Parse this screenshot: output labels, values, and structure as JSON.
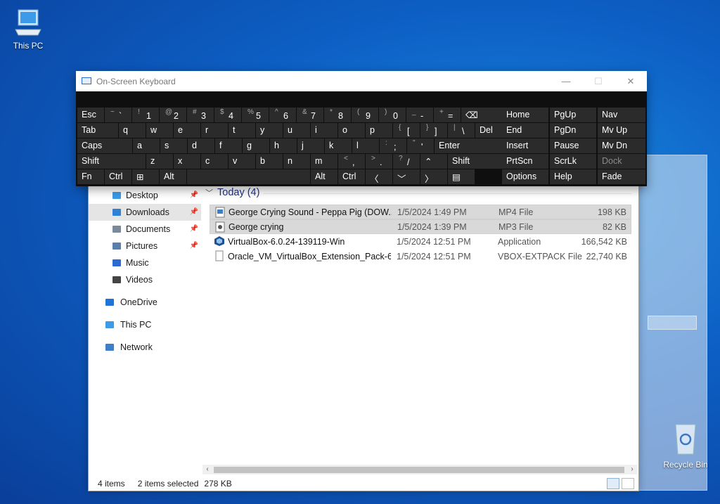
{
  "desktop": {
    "this_pc_label": "This PC",
    "recycle_bin_label": "Recycle Bin"
  },
  "osk": {
    "title": "On-Screen Keyboard",
    "window_controls": {
      "minimize": "—",
      "maximize": "☐",
      "close": "✕"
    },
    "rows": [
      [
        {
          "id": "esc",
          "label": "Esc"
        },
        {
          "id": "tilde",
          "shift": "~",
          "main": "`"
        },
        {
          "id": "k1",
          "shift": "!",
          "main": "1"
        },
        {
          "id": "k2",
          "shift": "@",
          "main": "2"
        },
        {
          "id": "k3",
          "shift": "#",
          "main": "3"
        },
        {
          "id": "k4",
          "shift": "$",
          "main": "4"
        },
        {
          "id": "k5",
          "shift": "%",
          "main": "5"
        },
        {
          "id": "k6",
          "shift": "^",
          "main": "6"
        },
        {
          "id": "k7",
          "shift": "&",
          "main": "7"
        },
        {
          "id": "k8",
          "shift": "*",
          "main": "8"
        },
        {
          "id": "k9",
          "shift": "(",
          "main": "9"
        },
        {
          "id": "k0",
          "shift": ")",
          "main": "0"
        },
        {
          "id": "minus",
          "shift": "_",
          "main": "-"
        },
        {
          "id": "equals",
          "shift": "+",
          "main": "="
        },
        {
          "id": "backspace",
          "label": "⌫"
        }
      ],
      [
        {
          "id": "tab",
          "label": "Tab"
        },
        {
          "id": "q",
          "label": "q"
        },
        {
          "id": "w",
          "label": "w"
        },
        {
          "id": "e",
          "label": "e"
        },
        {
          "id": "r",
          "label": "r"
        },
        {
          "id": "t",
          "label": "t"
        },
        {
          "id": "y",
          "label": "y"
        },
        {
          "id": "u",
          "label": "u"
        },
        {
          "id": "i",
          "label": "i"
        },
        {
          "id": "o",
          "label": "o"
        },
        {
          "id": "p",
          "label": "p"
        },
        {
          "id": "lbracket",
          "shift": "{",
          "main": "["
        },
        {
          "id": "rbracket",
          "shift": "}",
          "main": "]"
        },
        {
          "id": "backslash",
          "shift": "|",
          "main": "\\"
        },
        {
          "id": "del",
          "label": "Del"
        }
      ],
      [
        {
          "id": "caps",
          "label": "Caps"
        },
        {
          "id": "a",
          "label": "a"
        },
        {
          "id": "s",
          "label": "s"
        },
        {
          "id": "d",
          "label": "d"
        },
        {
          "id": "f",
          "label": "f"
        },
        {
          "id": "g",
          "label": "g"
        },
        {
          "id": "h",
          "label": "h"
        },
        {
          "id": "j",
          "label": "j"
        },
        {
          "id": "k",
          "label": "k"
        },
        {
          "id": "l",
          "label": "l"
        },
        {
          "id": "semicolon",
          "shift": ":",
          "main": ";"
        },
        {
          "id": "quote",
          "shift": "\"",
          "main": "'"
        },
        {
          "id": "enter",
          "label": "Enter"
        }
      ],
      [
        {
          "id": "lshift",
          "label": "Shift"
        },
        {
          "id": "z",
          "label": "z"
        },
        {
          "id": "x",
          "label": "x"
        },
        {
          "id": "c",
          "label": "c"
        },
        {
          "id": "v",
          "label": "v"
        },
        {
          "id": "b",
          "label": "b"
        },
        {
          "id": "n",
          "label": "n"
        },
        {
          "id": "m",
          "label": "m"
        },
        {
          "id": "comma",
          "shift": "<",
          "main": ","
        },
        {
          "id": "period",
          "shift": ">",
          "main": "."
        },
        {
          "id": "slash",
          "shift": "?",
          "main": "/"
        },
        {
          "id": "up",
          "label": "⌃"
        },
        {
          "id": "rshift",
          "label": "Shift"
        }
      ],
      [
        {
          "id": "fn",
          "label": "Fn"
        },
        {
          "id": "lctrl",
          "label": "Ctrl"
        },
        {
          "id": "win",
          "label": "⊞"
        },
        {
          "id": "lalt",
          "label": "Alt"
        },
        {
          "id": "space",
          "label": ""
        },
        {
          "id": "ralt",
          "label": "Alt"
        },
        {
          "id": "rctrl",
          "label": "Ctrl"
        },
        {
          "id": "left",
          "label": "〈"
        },
        {
          "id": "down",
          "label": "﹀"
        },
        {
          "id": "right",
          "label": "〉"
        },
        {
          "id": "menu",
          "label": "▤"
        }
      ]
    ],
    "nav_block": [
      [
        "Home",
        "PgUp",
        "Nav"
      ],
      [
        "End",
        "PgDn",
        "Mv Up"
      ],
      [
        "Insert",
        "Pause",
        "Mv Dn"
      ],
      [
        "PrtScn",
        "ScrLk",
        "Dock"
      ],
      [
        "Options",
        "Help",
        "Fade"
      ]
    ]
  },
  "explorer": {
    "nav": [
      {
        "label": "Desktop",
        "icon": "desktop-icon",
        "pinned": true,
        "active": false,
        "indent": 1
      },
      {
        "label": "Downloads",
        "icon": "downloads-icon",
        "pinned": true,
        "active": true,
        "indent": 1
      },
      {
        "label": "Documents",
        "icon": "documents-icon",
        "pinned": true,
        "active": false,
        "indent": 1
      },
      {
        "label": "Pictures",
        "icon": "pictures-icon",
        "pinned": true,
        "active": false,
        "indent": 1
      },
      {
        "label": "Music",
        "icon": "music-icon",
        "pinned": false,
        "active": false,
        "indent": 1
      },
      {
        "label": "Videos",
        "icon": "videos-icon",
        "pinned": false,
        "active": false,
        "indent": 1
      },
      {
        "label": "OneDrive",
        "icon": "onedrive-icon",
        "pinned": false,
        "active": false,
        "indent": 0
      },
      {
        "label": "This PC",
        "icon": "thispc-icon",
        "pinned": false,
        "active": false,
        "indent": 0
      },
      {
        "label": "Network",
        "icon": "network-icon",
        "pinned": false,
        "active": false,
        "indent": 0
      }
    ],
    "group_header": "Today (4)",
    "files": [
      {
        "name": "George Crying Sound -  Peppa Pig (DOW...",
        "date": "1/5/2024 1:49 PM",
        "type": "MP4 File",
        "size": "198 KB",
        "selected": true,
        "icon": "mp4-file-icon"
      },
      {
        "name": "George crying",
        "date": "1/5/2024 1:39 PM",
        "type": "MP3 File",
        "size": "82 KB",
        "selected": true,
        "icon": "mp3-file-icon"
      },
      {
        "name": "VirtualBox-6.0.24-139119-Win",
        "date": "1/5/2024 12:51 PM",
        "type": "Application",
        "size": "166,542 KB",
        "selected": false,
        "icon": "virtualbox-app-icon"
      },
      {
        "name": "Oracle_VM_VirtualBox_Extension_Pack-6....",
        "date": "1/5/2024 12:51 PM",
        "type": "VBOX-EXTPACK File",
        "size": "22,740 KB",
        "selected": false,
        "icon": "generic-file-icon"
      }
    ],
    "status": {
      "items": "4 items",
      "selected": "2 items selected",
      "size": "278 KB"
    }
  }
}
